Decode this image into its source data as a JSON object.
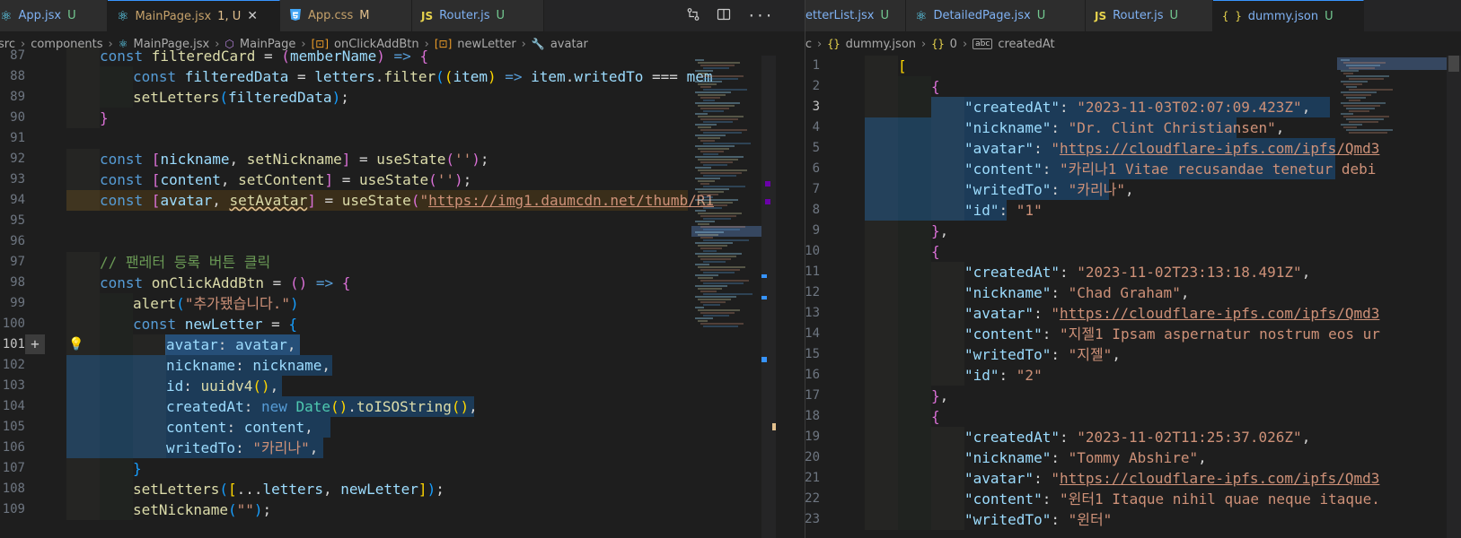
{
  "left_pane": {
    "tabs": [
      {
        "icon": "react-icon",
        "name": "App.jsx",
        "status": "U",
        "active": false
      },
      {
        "icon": "react-icon",
        "name": "MainPage.jsx",
        "status": "1, U",
        "active": true,
        "close": "✕"
      },
      {
        "icon": "css-icon",
        "name": "App.css",
        "status": "M",
        "active": false
      },
      {
        "icon": "js-icon",
        "name": "Router.js",
        "status": "U",
        "active": false
      }
    ],
    "breadcrumb": [
      "src",
      "components",
      "MainPage.jsx",
      "MainPage",
      "onClickAddBtn",
      "newLetter",
      "avatar"
    ],
    "lines": [
      {
        "n": 87,
        "tokens": [
          {
            "t": "const ",
            "c": "kw"
          },
          {
            "t": "filteredCard",
            "c": "fnc"
          },
          {
            "t": " = ",
            "c": "punc"
          },
          {
            "t": "(",
            "c": "br2"
          },
          {
            "t": "memberName",
            "c": "var"
          },
          {
            "t": ")",
            "c": "br2"
          },
          {
            "t": " => ",
            "c": "kw"
          },
          {
            "t": "{",
            "c": "br2"
          }
        ]
      },
      {
        "n": 88,
        "tokens": [
          {
            "t": "const ",
            "c": "kw"
          },
          {
            "t": "filteredData",
            "c": "var"
          },
          {
            "t": " = ",
            "c": "punc"
          },
          {
            "t": "letters",
            "c": "var"
          },
          {
            "t": ".",
            "c": "punc"
          },
          {
            "t": "filter",
            "c": "fnc"
          },
          {
            "t": "(",
            "c": "br3"
          },
          {
            "t": "(",
            "c": "br1"
          },
          {
            "t": "item",
            "c": "var"
          },
          {
            "t": ")",
            "c": "br1"
          },
          {
            "t": " => ",
            "c": "kw"
          },
          {
            "t": "item",
            "c": "var"
          },
          {
            "t": ".",
            "c": "punc"
          },
          {
            "t": "writedTo",
            "c": "prop"
          },
          {
            "t": " === ",
            "c": "punc"
          },
          {
            "t": "mem",
            "c": "var"
          }
        ]
      },
      {
        "n": 89,
        "tokens": [
          {
            "t": "setLetters",
            "c": "fnc"
          },
          {
            "t": "(",
            "c": "br3"
          },
          {
            "t": "filteredData",
            "c": "var"
          },
          {
            "t": ")",
            "c": "br3"
          },
          {
            "t": ";",
            "c": "punc"
          }
        ]
      },
      {
        "n": 90,
        "tokens": [
          {
            "t": "}",
            "c": "br2"
          }
        ]
      },
      {
        "n": 91,
        "tokens": []
      },
      {
        "n": 92,
        "tokens": [
          {
            "t": "const ",
            "c": "kw"
          },
          {
            "t": "[",
            "c": "br2"
          },
          {
            "t": "nickname",
            "c": "var"
          },
          {
            "t": ", ",
            "c": "punc"
          },
          {
            "t": "setNickname",
            "c": "fnc"
          },
          {
            "t": "]",
            "c": "br2"
          },
          {
            "t": " = ",
            "c": "punc"
          },
          {
            "t": "useState",
            "c": "fnc"
          },
          {
            "t": "(",
            "c": "br2"
          },
          {
            "t": "''",
            "c": "str"
          },
          {
            "t": ")",
            "c": "br2"
          },
          {
            "t": ";",
            "c": "punc"
          }
        ]
      },
      {
        "n": 93,
        "tokens": [
          {
            "t": "const ",
            "c": "kw"
          },
          {
            "t": "[",
            "c": "br2"
          },
          {
            "t": "content",
            "c": "var"
          },
          {
            "t": ", ",
            "c": "punc"
          },
          {
            "t": "setContent",
            "c": "fnc"
          },
          {
            "t": "]",
            "c": "br2"
          },
          {
            "t": " = ",
            "c": "punc"
          },
          {
            "t": "useState",
            "c": "fnc"
          },
          {
            "t": "(",
            "c": "br2"
          },
          {
            "t": "''",
            "c": "str"
          },
          {
            "t": ")",
            "c": "br2"
          },
          {
            "t": ";",
            "c": "punc"
          }
        ]
      },
      {
        "n": 94,
        "tokens": [
          {
            "t": "const ",
            "c": "kw"
          },
          {
            "t": "[",
            "c": "br2"
          },
          {
            "t": "avatar",
            "c": "var"
          },
          {
            "t": ", ",
            "c": "punc"
          },
          {
            "t": "setAvatar",
            "c": "fnc warn"
          },
          {
            "t": "]",
            "c": "br2"
          },
          {
            "t": " = ",
            "c": "punc"
          },
          {
            "t": "useState",
            "c": "fnc"
          },
          {
            "t": "(",
            "c": "br2"
          },
          {
            "t": "\"",
            "c": "str"
          },
          {
            "t": "https://img1.daumcdn.net/thumb/R1",
            "c": "url"
          }
        ]
      },
      {
        "n": 95,
        "tokens": []
      },
      {
        "n": 96,
        "tokens": []
      },
      {
        "n": 97,
        "tokens": [
          {
            "t": "// 팬레터 등록 버튼 클릭",
            "c": "cmt"
          }
        ]
      },
      {
        "n": 98,
        "tokens": [
          {
            "t": "const ",
            "c": "kw"
          },
          {
            "t": "onClickAddBtn",
            "c": "fnc"
          },
          {
            "t": " = ",
            "c": "punc"
          },
          {
            "t": "()",
            "c": "br2"
          },
          {
            "t": " => ",
            "c": "kw"
          },
          {
            "t": "{",
            "c": "br2"
          }
        ]
      },
      {
        "n": 99,
        "tokens": [
          {
            "t": "alert",
            "c": "fnc"
          },
          {
            "t": "(",
            "c": "br3"
          },
          {
            "t": "\"추가됐습니다.\"",
            "c": "str"
          },
          {
            "t": ")",
            "c": "br3"
          }
        ]
      },
      {
        "n": 100,
        "tokens": [
          {
            "t": "const ",
            "c": "kw"
          },
          {
            "t": "newLetter",
            "c": "var"
          },
          {
            "t": " = ",
            "c": "punc"
          },
          {
            "t": "{",
            "c": "br3"
          }
        ]
      },
      {
        "n": 101,
        "tokens": [
          {
            "t": "avatar",
            "c": "prop"
          },
          {
            "t": ": ",
            "c": "punc"
          },
          {
            "t": "avatar",
            "c": "var"
          },
          {
            "t": ",",
            "c": "punc"
          }
        ]
      },
      {
        "n": 102,
        "tokens": [
          {
            "t": "nickname",
            "c": "prop"
          },
          {
            "t": ": ",
            "c": "punc"
          },
          {
            "t": "nickname",
            "c": "var"
          },
          {
            "t": ",",
            "c": "punc"
          }
        ]
      },
      {
        "n": 103,
        "tokens": [
          {
            "t": "id",
            "c": "prop"
          },
          {
            "t": ": ",
            "c": "punc"
          },
          {
            "t": "uuidv4",
            "c": "fnc"
          },
          {
            "t": "()",
            "c": "br1"
          },
          {
            "t": ",",
            "c": "punc"
          }
        ]
      },
      {
        "n": 104,
        "tokens": [
          {
            "t": "createdAt",
            "c": "prop"
          },
          {
            "t": ": ",
            "c": "punc"
          },
          {
            "t": "new ",
            "c": "kw"
          },
          {
            "t": "Date",
            "c": "cls"
          },
          {
            "t": "()",
            "c": "br1"
          },
          {
            "t": ".",
            "c": "punc"
          },
          {
            "t": "toISOString",
            "c": "fnc"
          },
          {
            "t": "()",
            "c": "br1"
          },
          {
            "t": ",",
            "c": "punc"
          }
        ]
      },
      {
        "n": 105,
        "tokens": [
          {
            "t": "content",
            "c": "prop"
          },
          {
            "t": ": ",
            "c": "punc"
          },
          {
            "t": "content",
            "c": "var"
          },
          {
            "t": ",",
            "c": "punc"
          }
        ]
      },
      {
        "n": 106,
        "tokens": [
          {
            "t": "writedTo",
            "c": "prop"
          },
          {
            "t": ": ",
            "c": "punc"
          },
          {
            "t": "\"카리나\"",
            "c": "str"
          },
          {
            "t": ",",
            "c": "punc"
          }
        ]
      },
      {
        "n": 107,
        "tokens": [
          {
            "t": "}",
            "c": "br3"
          }
        ]
      },
      {
        "n": 108,
        "tokens": [
          {
            "t": "setLetters",
            "c": "fnc"
          },
          {
            "t": "(",
            "c": "br3"
          },
          {
            "t": "[",
            "c": "br1"
          },
          {
            "t": "...",
            "c": "punc"
          },
          {
            "t": "letters",
            "c": "var"
          },
          {
            "t": ", ",
            "c": "punc"
          },
          {
            "t": "newLetter",
            "c": "var"
          },
          {
            "t": "]",
            "c": "br1"
          },
          {
            "t": ")",
            "c": "br3"
          },
          {
            "t": ";",
            "c": "punc"
          }
        ]
      },
      {
        "n": 109,
        "tokens": [
          {
            "t": "setNickname",
            "c": "fnc"
          },
          {
            "t": "(",
            "c": "br3"
          },
          {
            "t": "\"\"",
            "c": "str"
          },
          {
            "t": ")",
            "c": "br3"
          },
          {
            "t": ";",
            "c": "punc"
          }
        ]
      }
    ]
  },
  "right_pane": {
    "tabs": [
      {
        "icon": "react-icon",
        "name": "etterList.jsx",
        "status": "U",
        "active": false
      },
      {
        "icon": "react-icon",
        "name": "DetailedPage.jsx",
        "status": "U",
        "active": false
      },
      {
        "icon": "js-icon",
        "name": "Router.js",
        "status": "U",
        "active": false
      },
      {
        "icon": "json-icon",
        "name": "dummy.json",
        "status": "U",
        "active": true
      }
    ],
    "breadcrumb": [
      "src",
      "dummy.json",
      "0",
      "createdAt"
    ],
    "lines": [
      {
        "n": 1,
        "tokens": [
          {
            "t": "[",
            "c": "br1"
          }
        ]
      },
      {
        "n": 2,
        "tokens": [
          {
            "t": "{",
            "c": "br2"
          }
        ]
      },
      {
        "n": 3,
        "tokens": [
          {
            "t": "\"createdAt\"",
            "c": "key"
          },
          {
            "t": ": ",
            "c": "punc"
          },
          {
            "t": "\"2023-11-03T02:07:09.423Z\"",
            "c": "str"
          },
          {
            "t": ",",
            "c": "punc"
          }
        ]
      },
      {
        "n": 4,
        "tokens": [
          {
            "t": "\"nickname\"",
            "c": "key"
          },
          {
            "t": ": ",
            "c": "punc"
          },
          {
            "t": "\"Dr. Clint Christiansen\"",
            "c": "str"
          },
          {
            "t": ",",
            "c": "punc"
          }
        ]
      },
      {
        "n": 5,
        "tokens": [
          {
            "t": "\"avatar\"",
            "c": "key"
          },
          {
            "t": ": ",
            "c": "punc"
          },
          {
            "t": "\"",
            "c": "str"
          },
          {
            "t": "https://cloudflare-ipfs.com/ipfs/Qmd3",
            "c": "url"
          }
        ]
      },
      {
        "n": 6,
        "tokens": [
          {
            "t": "\"content\"",
            "c": "key"
          },
          {
            "t": ": ",
            "c": "punc"
          },
          {
            "t": "\"카리나1 Vitae recusandae tenetur debi",
            "c": "str"
          }
        ]
      },
      {
        "n": 7,
        "tokens": [
          {
            "t": "\"writedTo\"",
            "c": "key"
          },
          {
            "t": ": ",
            "c": "punc"
          },
          {
            "t": "\"카리나\"",
            "c": "str"
          },
          {
            "t": ",",
            "c": "punc"
          }
        ]
      },
      {
        "n": 8,
        "tokens": [
          {
            "t": "\"id\"",
            "c": "key"
          },
          {
            "t": ": ",
            "c": "punc"
          },
          {
            "t": "\"1\"",
            "c": "str"
          }
        ]
      },
      {
        "n": 9,
        "tokens": [
          {
            "t": "}",
            "c": "br2"
          },
          {
            "t": ",",
            "c": "punc"
          }
        ]
      },
      {
        "n": 10,
        "tokens": [
          {
            "t": "{",
            "c": "br2"
          }
        ]
      },
      {
        "n": 11,
        "tokens": [
          {
            "t": "\"createdAt\"",
            "c": "key"
          },
          {
            "t": ": ",
            "c": "punc"
          },
          {
            "t": "\"2023-11-02T23:13:18.491Z\"",
            "c": "str"
          },
          {
            "t": ",",
            "c": "punc"
          }
        ]
      },
      {
        "n": 12,
        "tokens": [
          {
            "t": "\"nickname\"",
            "c": "key"
          },
          {
            "t": ": ",
            "c": "punc"
          },
          {
            "t": "\"Chad Graham\"",
            "c": "str"
          },
          {
            "t": ",",
            "c": "punc"
          }
        ]
      },
      {
        "n": 13,
        "tokens": [
          {
            "t": "\"avatar\"",
            "c": "key"
          },
          {
            "t": ": ",
            "c": "punc"
          },
          {
            "t": "\"",
            "c": "str"
          },
          {
            "t": "https://cloudflare-ipfs.com/ipfs/Qmd3",
            "c": "url"
          }
        ]
      },
      {
        "n": 14,
        "tokens": [
          {
            "t": "\"content\"",
            "c": "key"
          },
          {
            "t": ": ",
            "c": "punc"
          },
          {
            "t": "\"지젤1 Ipsam aspernatur nostrum eos ur",
            "c": "str"
          }
        ]
      },
      {
        "n": 15,
        "tokens": [
          {
            "t": "\"writedTo\"",
            "c": "key"
          },
          {
            "t": ": ",
            "c": "punc"
          },
          {
            "t": "\"지젤\"",
            "c": "str"
          },
          {
            "t": ",",
            "c": "punc"
          }
        ]
      },
      {
        "n": 16,
        "tokens": [
          {
            "t": "\"id\"",
            "c": "key"
          },
          {
            "t": ": ",
            "c": "punc"
          },
          {
            "t": "\"2\"",
            "c": "str"
          }
        ]
      },
      {
        "n": 17,
        "tokens": [
          {
            "t": "}",
            "c": "br2"
          },
          {
            "t": ",",
            "c": "punc"
          }
        ]
      },
      {
        "n": 18,
        "tokens": [
          {
            "t": "{",
            "c": "br2"
          }
        ]
      },
      {
        "n": 19,
        "tokens": [
          {
            "t": "\"createdAt\"",
            "c": "key"
          },
          {
            "t": ": ",
            "c": "punc"
          },
          {
            "t": "\"2023-11-02T11:25:37.026Z\"",
            "c": "str"
          },
          {
            "t": ",",
            "c": "punc"
          }
        ]
      },
      {
        "n": 20,
        "tokens": [
          {
            "t": "\"nickname\"",
            "c": "key"
          },
          {
            "t": ": ",
            "c": "punc"
          },
          {
            "t": "\"Tommy Abshire\"",
            "c": "str"
          },
          {
            "t": ",",
            "c": "punc"
          }
        ]
      },
      {
        "n": 21,
        "tokens": [
          {
            "t": "\"avatar\"",
            "c": "key"
          },
          {
            "t": ": ",
            "c": "punc"
          },
          {
            "t": "\"",
            "c": "str"
          },
          {
            "t": "https://cloudflare-ipfs.com/ipfs/Qmd3",
            "c": "url"
          }
        ]
      },
      {
        "n": 22,
        "tokens": [
          {
            "t": "\"content\"",
            "c": "key"
          },
          {
            "t": ": ",
            "c": "punc"
          },
          {
            "t": "\"윈터1 Itaque nihil quae neque itaque.",
            "c": "str"
          }
        ]
      },
      {
        "n": 23,
        "tokens": [
          {
            "t": "\"writedTo\"",
            "c": "key"
          },
          {
            "t": ": ",
            "c": "punc"
          },
          {
            "t": "\"윈터\"",
            "c": "str"
          }
        ]
      }
    ]
  }
}
